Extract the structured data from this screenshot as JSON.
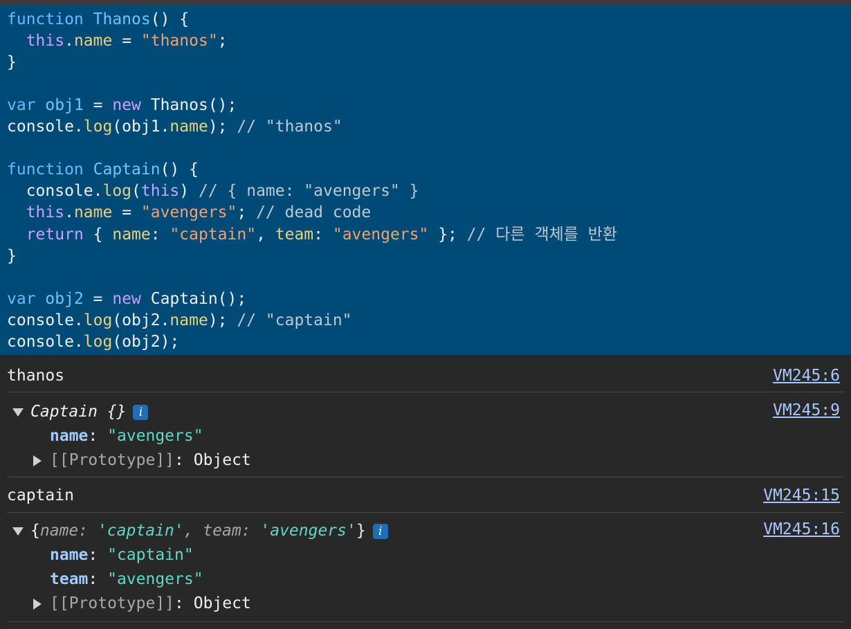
{
  "editor": {
    "lines": [
      "function Thanos() {",
      "  this.name = \"thanos\";",
      "}",
      "",
      "var obj1 = new Thanos();",
      "console.log(obj1.name); // \"thanos\"",
      "",
      "function Captain() {",
      "  console.log(this) // { name: \"avengers\" }",
      "  this.name = \"avengers\"; // dead code",
      "  return { name: \"captain\", team: \"avengers\" }; // 다른 객체를 반환",
      "}",
      "",
      "var obj2 = new Captain();",
      "console.log(obj2.name); // \"captain\"",
      "console.log(obj2);"
    ],
    "tokens": {
      "l1": [
        "function",
        " ",
        "Thanos",
        "() {"
      ],
      "l2": [
        "  ",
        "this",
        ".",
        "name",
        " = ",
        "\"thanos\"",
        ";"
      ],
      "l3": [
        "}"
      ],
      "l5": [
        "var",
        " ",
        "obj1",
        " = ",
        "new",
        " Thanos();"
      ],
      "l6": [
        "console.",
        "log",
        "(obj1.",
        "name",
        "); ",
        "// \"thanos\""
      ],
      "l8": [
        "function",
        " ",
        "Captain",
        "() {"
      ],
      "l9": [
        "  console.",
        "log",
        "(",
        "this",
        ") ",
        "// { name: \"avengers\" }"
      ],
      "l10": [
        "  ",
        "this",
        ".",
        "name",
        " = ",
        "\"avengers\"",
        "; ",
        "// dead code"
      ],
      "l11": [
        "  ",
        "return",
        " { ",
        "name",
        ": ",
        "\"captain\"",
        ", ",
        "team",
        ": ",
        "\"avengers\"",
        " }; ",
        "// 다른 객체를 반환"
      ],
      "l12": [
        "}"
      ],
      "l14": [
        "var",
        " ",
        "obj2",
        " = ",
        "new",
        " Captain();"
      ],
      "l15": [
        "console.",
        "log",
        "(obj2.",
        "name",
        "); ",
        "// \"captain\""
      ],
      "l16": [
        "console.",
        "log",
        "(obj2);"
      ]
    }
  },
  "console": {
    "entries": [
      {
        "text": "thanos",
        "source": "VM245:6"
      },
      {
        "source": "VM245:9",
        "summary": "Captain {}",
        "info": "i",
        "props": [
          {
            "key": "name",
            "value": "\"avengers\""
          }
        ],
        "prototype_label": "[[Prototype]]",
        "prototype_value": "Object"
      },
      {
        "text": "captain",
        "source": "VM245:15"
      },
      {
        "source": "VM245:16",
        "summary_open": "{",
        "summary_parts": [
          "name",
          ": ",
          "'captain'",
          ", ",
          "team",
          ": ",
          "'avengers'"
        ],
        "summary_close": "}",
        "info": "i",
        "props": [
          {
            "key": "name",
            "value": "\"captain\""
          },
          {
            "key": "team",
            "value": "\"avengers\""
          }
        ],
        "prototype_label": "[[Prototype]]",
        "prototype_value": "Object"
      }
    ],
    "separator": ": "
  },
  "colors": {
    "editor_bg": "#004a78",
    "console_bg": "#282828",
    "keyword": "#c9a0ff",
    "string": "#f3a074",
    "property": "#e9d27a",
    "link": "#a9c7ff",
    "console_string": "#5fd8c6"
  },
  "icons": {
    "expand_open": "triangle-down-icon",
    "expand_closed": "triangle-right-icon",
    "info": "info-icon"
  }
}
